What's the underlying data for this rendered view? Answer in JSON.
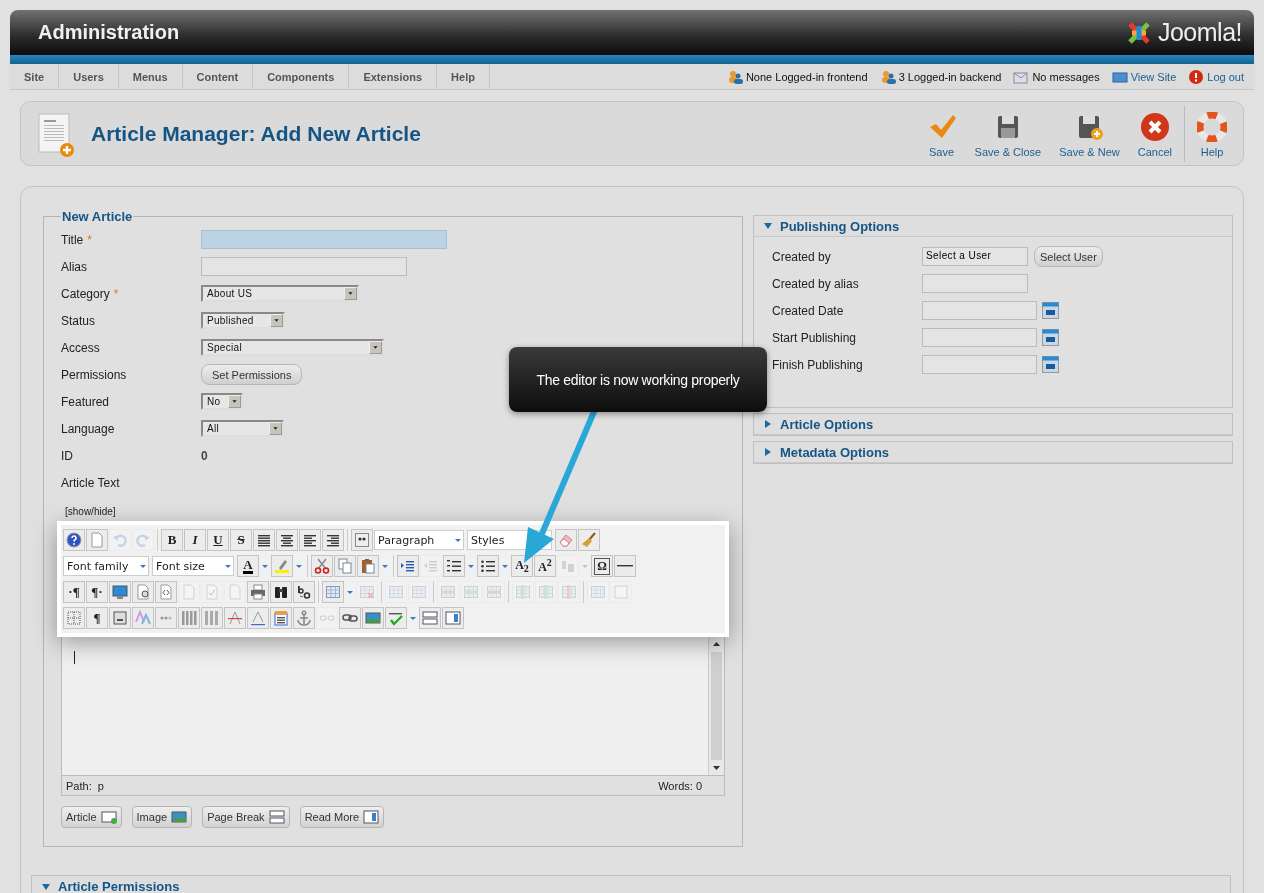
{
  "header": {
    "title": "Administration",
    "logo": "Joomla!"
  },
  "menu": [
    {
      "label": "Site"
    },
    {
      "label": "Users"
    },
    {
      "label": "Menus"
    },
    {
      "label": "Content"
    },
    {
      "label": "Components"
    },
    {
      "label": "Extensions"
    },
    {
      "label": "Help"
    }
  ],
  "status": [
    {
      "kind": "users",
      "label": "None Logged-in frontend"
    },
    {
      "kind": "users",
      "label": "3 Logged-in backend"
    },
    {
      "kind": "mail",
      "label": "No messages"
    },
    {
      "kind": "site",
      "label": "View Site"
    },
    {
      "kind": "logout",
      "label": "Log out"
    }
  ],
  "page_title": "Article Manager: Add New Article",
  "actions": [
    {
      "kind": "save",
      "label": "Save"
    },
    {
      "kind": "save_close",
      "label": "Save & Close"
    },
    {
      "kind": "save_new",
      "label": "Save & New"
    },
    {
      "kind": "cancel",
      "label": "Cancel"
    },
    {
      "kind": "help",
      "label": "Help"
    }
  ],
  "form": {
    "legend": "New Article",
    "fields": [
      {
        "kind": "text",
        "label": "Title",
        "required_mark": "*",
        "focused": true
      },
      {
        "kind": "text",
        "label": "Alias",
        "focused": false
      },
      {
        "kind": "select",
        "label": "Category",
        "required_mark": "*",
        "value": "About US"
      },
      {
        "kind": "select",
        "label": "Status",
        "value": "Published"
      },
      {
        "kind": "select",
        "label": "Access",
        "value": "Special"
      },
      {
        "kind": "button",
        "label": "Permissions",
        "value": "Set Permissions"
      },
      {
        "kind": "select",
        "label": "Featured",
        "value": "No"
      },
      {
        "kind": "select",
        "label": "Language",
        "value": "All"
      },
      {
        "kind": "static",
        "label": "ID",
        "value": "0"
      },
      {
        "kind": "static",
        "label": "Article Text"
      }
    ]
  },
  "editor": {
    "toggle": "[show/hide]",
    "toolbar": [
      [
        [
          {
            "kind": "help",
            "disabled": false
          },
          {
            "kind": "page",
            "disabled": false
          },
          {
            "kind": "undo",
            "disabled": true
          },
          {
            "kind": "redo",
            "disabled": true
          }
        ],
        [
          {
            "kind": "bold",
            "label": "B",
            "disabled": false
          },
          {
            "kind": "italic",
            "label": "I",
            "disabled": false
          },
          {
            "kind": "underline",
            "label": "U",
            "disabled": false
          },
          {
            "kind": "strike",
            "label": "S",
            "disabled": false
          },
          {
            "kind": "justify",
            "disabled": false
          },
          {
            "kind": "center",
            "disabled": false
          },
          {
            "kind": "left",
            "disabled": false
          },
          {
            "kind": "right",
            "disabled": false
          }
        ],
        [
          {
            "kind": "quote",
            "disabled": false
          },
          {
            "kind": "select",
            "label": "Paragraph",
            "disabled": false
          },
          {
            "kind": "select",
            "label": "Styles",
            "disabled": false
          },
          {
            "kind": "eraser",
            "disabled": false
          },
          {
            "kind": "brush",
            "disabled": false
          }
        ]
      ],
      [
        [
          {
            "kind": "select",
            "label": "Font family",
            "disabled": false
          },
          {
            "kind": "select",
            "label": "Font size",
            "disabled": false
          },
          {
            "kind": "textcolor",
            "label": "A",
            "menu": true,
            "disabled": false
          },
          {
            "kind": "highlight",
            "menu": true,
            "disabled": false
          }
        ],
        [
          {
            "kind": "cut",
            "disabled": false
          },
          {
            "kind": "copy",
            "disabled": false
          },
          {
            "kind": "paste",
            "menu": true,
            "disabled": false
          }
        ],
        [
          {
            "kind": "indent",
            "disabled": false
          },
          {
            "kind": "outdent",
            "disabled": true
          },
          {
            "kind": "olist",
            "menu": true,
            "disabled": false
          },
          {
            "kind": "ulist",
            "menu": true,
            "disabled": false
          },
          {
            "kind": "subscript",
            "label": "A$_{2}$",
            "disabled": false
          },
          {
            "kind": "superscript",
            "label": "A$^{2}$",
            "disabled": false
          },
          {
            "kind": "stylecolor",
            "menu": true,
            "disabled": true
          },
          {
            "kind": "omega",
            "label": "Ω",
            "disabled": false
          },
          {
            "kind": "hr",
            "disabled": false
          }
        ]
      ],
      [
        [
          {
            "kind": "ltr",
            "label": "·¶",
            "disabled": false
          },
          {
            "kind": "rtl",
            "label": "¶·",
            "disabled": false
          },
          {
            "kind": "monitor",
            "disabled": false
          },
          {
            "kind": "preview",
            "disabled": false
          },
          {
            "kind": "code",
            "disabled": false
          },
          {
            "kind": "page",
            "disabled": true
          },
          {
            "kind": "check",
            "disabled": true
          },
          {
            "kind": "page",
            "disabled": true
          },
          {
            "kind": "print",
            "disabled": false
          },
          {
            "kind": "binoculars",
            "disabled": false
          },
          {
            "kind": "replace",
            "disabled": false
          }
        ],
        [
          {
            "kind": "table",
            "menu": true,
            "disabled": false
          },
          {
            "kind": "tabledelete",
            "disabled": true
          }
        ],
        [
          {
            "kind": "table",
            "disabled": true
          },
          {
            "kind": "table",
            "disabled": true
          }
        ],
        [
          {
            "kind": "tablerow",
            "disabled": true
          },
          {
            "kind": "tablerow",
            "disabled": true
          },
          {
            "kind": "tablerowdelete",
            "disabled": true
          }
        ],
        [
          {
            "kind": "tablecol",
            "disabled": true
          },
          {
            "kind": "tablecol",
            "disabled": true
          },
          {
            "kind": "tablecoldelete",
            "disabled": true
          }
        ],
        [
          {
            "kind": "table",
            "disabled": true
          },
          {
            "kind": "frame",
            "disabled": true
          }
        ]
      ],
      [
        [
          {
            "kind": "visualaid",
            "disabled": false
          },
          {
            "kind": "pilcrow",
            "label": "¶",
            "disabled": false
          },
          {
            "kind": "template",
            "disabled": false
          },
          {
            "kind": "styleprops",
            "disabled": false
          },
          {
            "kind": "cite",
            "disabled": false
          },
          {
            "kind": "abbr",
            "disabled": false
          },
          {
            "kind": "acronym",
            "disabled": false
          },
          {
            "kind": "del",
            "disabled": false
          },
          {
            "kind": "ins",
            "disabled": false
          },
          {
            "kind": "attribs",
            "disabled": false
          },
          {
            "kind": "anchor",
            "disabled": false
          },
          {
            "kind": "unlink",
            "disabled": true
          },
          {
            "kind": "link",
            "disabled": false
          },
          {
            "kind": "image",
            "disabled": false
          },
          {
            "kind": "spellcheck",
            "menu": true,
            "disabled": false
          },
          {
            "kind": "pagebreak",
            "disabled": false
          },
          {
            "kind": "readmore",
            "disabled": false
          }
        ]
      ]
    ],
    "path": "Path:  p",
    "words": "Words: 0",
    "buttons": [
      {
        "kind": "article",
        "label": "Article"
      },
      {
        "kind": "image",
        "label": "Image"
      },
      {
        "kind": "pagebreak",
        "label": "Page Break"
      },
      {
        "kind": "readmore",
        "label": "Read More"
      }
    ]
  },
  "panels": [
    {
      "title": "Publishing Options",
      "expanded": true,
      "fields": [
        {
          "label": "Created by",
          "value": "Select a User",
          "button": "Select User"
        },
        {
          "label": "Created by alias"
        },
        {
          "label": "Created Date",
          "calendar": true
        },
        {
          "label": "Start Publishing",
          "calendar": true
        },
        {
          "label": "Finish Publishing",
          "calendar": true
        }
      ]
    },
    {
      "title": "Article Options",
      "expanded": false
    },
    {
      "title": "Metadata Options",
      "expanded": false
    }
  ],
  "bottom_panel": {
    "title": "Article Permissions",
    "expanded": true
  },
  "callout": {
    "text": "The editor is now working properly"
  }
}
